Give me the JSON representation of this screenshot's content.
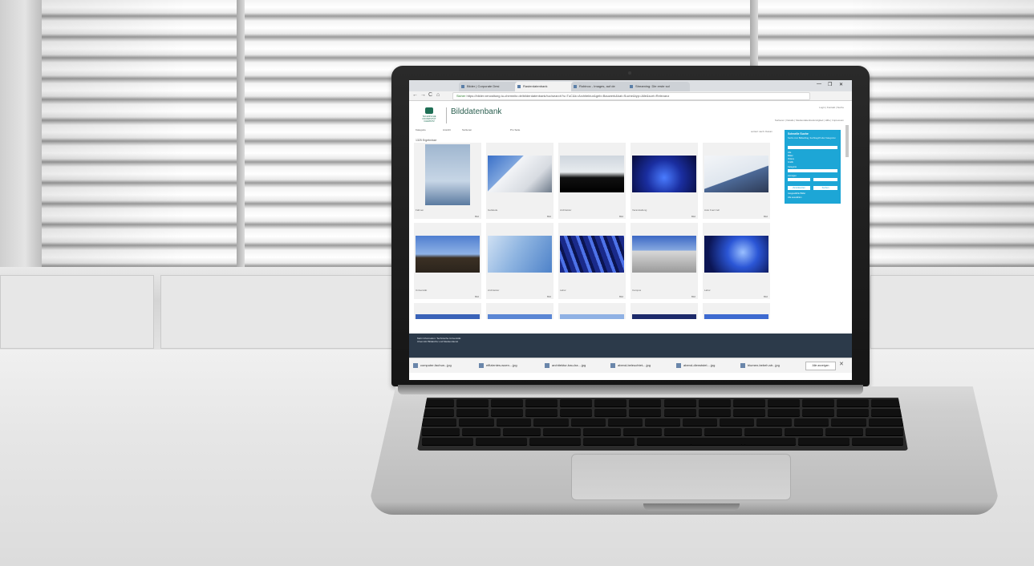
{
  "browser": {
    "tabs": [
      {
        "label": "Bilder | Corporate Desi"
      },
      {
        "label": "Rasterdatenbank"
      },
      {
        "label": "Robinoc - Images, auf de"
      },
      {
        "label": "Streaming: Die erste sol"
      }
    ],
    "window_controls": [
      "—",
      "❐",
      "✕"
    ],
    "nav": {
      "back": "←",
      "forward": "→",
      "reload": "C",
      "home": "⌂",
      "secure_label": "Sicher"
    },
    "url": "https://bilder.verwaltung.tu-chemnitz.de/bilderdatenbank/tuc/search?s=TuC&k=Architektur&geb=Bauwerk&kat=Suche&typ=Alle&sort=Relevanz"
  },
  "page": {
    "logo_text": "TECHNISCHE UNIVERSITÄT CHEMNITZ",
    "site_title": "Bilddatenbank",
    "top_links": "Login | Kontakt | Suche",
    "sub_links": "Sortieren | Details | Mediendatenbankmitglied | Hilfe | Impressum",
    "filters": [
      {
        "label": "Kategorie"
      },
      {
        "label": "Ansicht"
      },
      {
        "label": "Sortieren"
      },
      {
        "label": "Pro Seite"
      }
    ],
    "sort_info": "sortiert nach: Datum",
    "results_label": "1325 Ergebnisse",
    "cards": [
      {
        "caption": "Fahnen",
        "action": "Bild"
      },
      {
        "caption": "Gebäude",
        "action": "Bild"
      },
      {
        "caption": "Architektur",
        "action": "Bild"
      },
      {
        "caption": "Veranstaltung",
        "action": "Bild"
      },
      {
        "caption": "Auto Fuel Cell",
        "action": "Bild"
      },
      {
        "caption": "Universität",
        "action": "Bild"
      },
      {
        "caption": "Architektur",
        "action": "Bild"
      },
      {
        "caption": "Labor",
        "action": "Bild"
      },
      {
        "caption": "Campus",
        "action": "Bild"
      },
      {
        "caption": "Labor",
        "action": "Bild"
      }
    ],
    "side_panel": {
      "heading": "Schnelle Suche",
      "text": "Suche zum Bildauftrag, Suchbegriff oder Kategorien",
      "radios": [
        "Alle",
        "Bilder",
        "Videos",
        "Grafik"
      ],
      "label2": "Kategorie",
      "label3": "Anzeigen",
      "button1": "Zurücksetzen",
      "button2": "Suchen",
      "link1": "Ausgewählte Bilder",
      "link2": "Alle auswählen"
    },
    "footer_text": "Mehr Information: Technische Universität Chemnitz Bildarchiv und Mediendienst"
  },
  "downloads": {
    "items": [
      {
        "label": "computer-fachun...jpg"
      },
      {
        "label": "effizientes-woen....jpg"
      },
      {
        "label": "architektur-bau-ba....jpg"
      },
      {
        "label": "abend-beleuchtet-...jpg"
      },
      {
        "label": "abend-dienststel-...jpg"
      },
      {
        "label": "blumen-bebeh-str...jpg"
      }
    ],
    "show_all": "Alle anzeigen",
    "close": "✕"
  },
  "colors": {
    "accent": "#1da6d6",
    "brand_green": "#1f6f55",
    "footer_dark": "#2c3a4a"
  }
}
